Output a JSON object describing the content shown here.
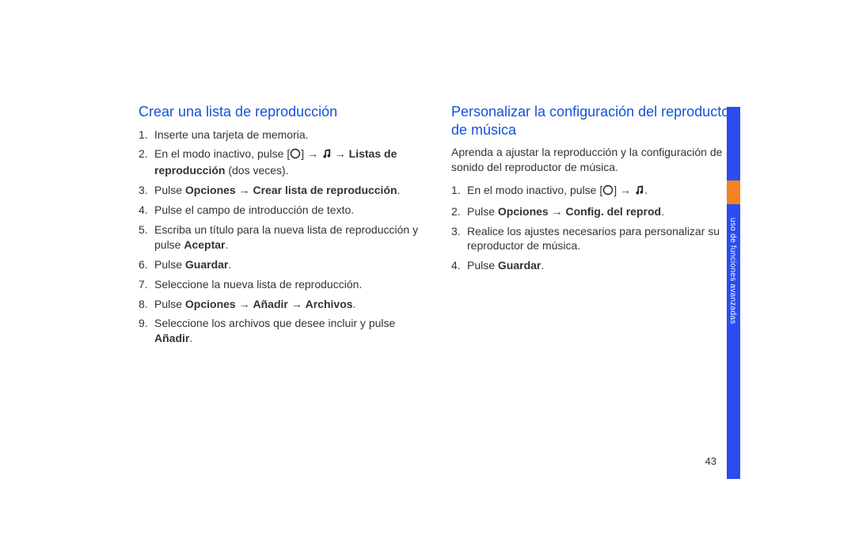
{
  "sidebar": {
    "label": "uso de funciones avanzadas"
  },
  "page_number": "43",
  "left": {
    "heading": "Crear una lista de reproducción",
    "items": [
      {
        "n": "1.",
        "pre": "Inserte una tarjeta de memoria."
      },
      {
        "n": "2.",
        "pre": "En el modo inactivo, pulse [",
        "mid": "] → ",
        "after_music": " → ",
        "bold": "Listas de reproducción",
        "post": " (dos veces)."
      },
      {
        "n": "3.",
        "pre": "Pulse ",
        "bold": "Opciones",
        "mid2": " → ",
        "bold2": "Crear lista de reproducción",
        "post": "."
      },
      {
        "n": "4.",
        "pre": "Pulse el campo de introducción de texto."
      },
      {
        "n": "5.",
        "pre": "Escriba un título para la nueva lista de reproducción y pulse ",
        "bold": "Aceptar",
        "post": "."
      },
      {
        "n": "6.",
        "pre": "Pulse ",
        "bold": "Guardar",
        "post": "."
      },
      {
        "n": "7.",
        "pre": "Seleccione la nueva lista de reproducción."
      },
      {
        "n": "8.",
        "pre": "Pulse ",
        "bold": "Opciones",
        "mid2": " → ",
        "bold2": "Añadir",
        "mid3": " → ",
        "bold3": "Archivos",
        "post": "."
      },
      {
        "n": "9.",
        "pre": "Seleccione los archivos que desee incluir y pulse ",
        "bold": "Añadir",
        "post": "."
      }
    ]
  },
  "right": {
    "heading": "Personalizar la configuración del reproductor de música",
    "lead": "Aprenda a ajustar la reproducción y la configuración de sonido del reproductor de música.",
    "items": [
      {
        "n": "1.",
        "pre": "En el modo inactivo, pulse [",
        "mid": "] → ",
        "post_music": "."
      },
      {
        "n": "2.",
        "pre": "Pulse ",
        "bold": "Opciones",
        "mid2": " → ",
        "bold2": "Config. del reprod",
        "post": "."
      },
      {
        "n": "3.",
        "pre": "Realice los ajustes necesarios para personalizar su reproductor de música."
      },
      {
        "n": "4.",
        "pre": "Pulse ",
        "bold": "Guardar",
        "post": "."
      }
    ]
  }
}
